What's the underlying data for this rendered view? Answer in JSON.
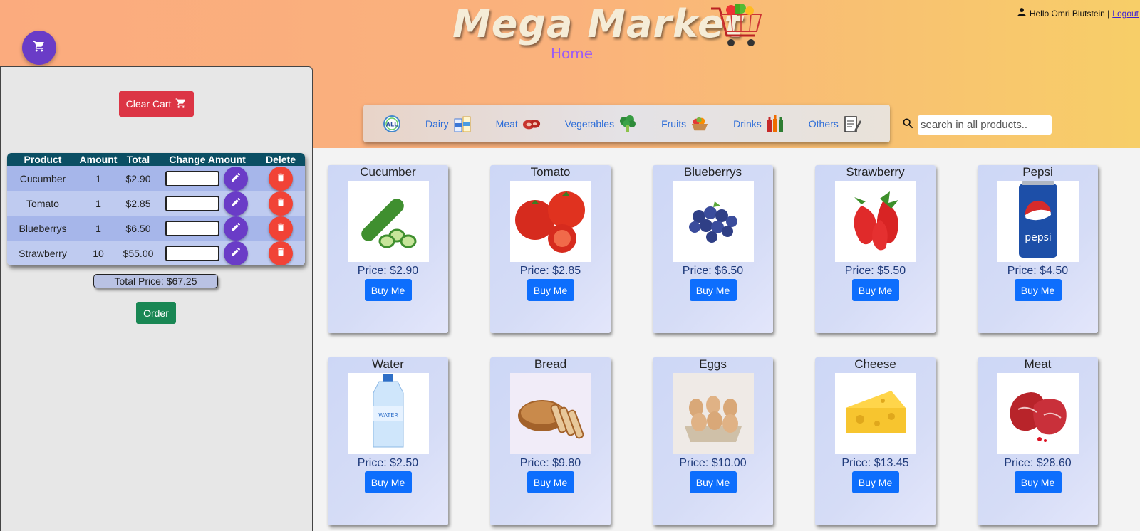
{
  "header": {
    "brand": "Mega Market",
    "nav_home": "Home",
    "greeting": "Hello Omri Blutstein |",
    "logout": "Logout"
  },
  "cart": {
    "clear_label": "Clear Cart",
    "columns": [
      "Product",
      "Amount",
      "Total",
      "Change Amount",
      "Delete"
    ],
    "rows": [
      {
        "product": "Cucumber",
        "amount": "1",
        "total": "$2.90"
      },
      {
        "product": "Tomato",
        "amount": "1",
        "total": "$2.85"
      },
      {
        "product": "Blueberrys",
        "amount": "1",
        "total": "$6.50"
      },
      {
        "product": "Strawberry",
        "amount": "10",
        "total": "$55.00"
      }
    ],
    "total_price": "Total Price: $67.25",
    "order_label": "Order"
  },
  "categories": {
    "items": [
      {
        "label": "ALL",
        "icon": "all-icon"
      },
      {
        "label": "Dairy",
        "icon": "dairy-icon"
      },
      {
        "label": "Meat",
        "icon": "meat-icon"
      },
      {
        "label": "Vegetables",
        "icon": "broccoli-icon"
      },
      {
        "label": "Fruits",
        "icon": "fruit-basket-icon"
      },
      {
        "label": "Drinks",
        "icon": "bottles-icon"
      },
      {
        "label": "Others",
        "icon": "notepad-icon"
      }
    ]
  },
  "search": {
    "placeholder": "search in all products.."
  },
  "products": [
    {
      "name": "Cucumber",
      "price": "Price: $2.90",
      "buy": "Buy Me",
      "image": "cucumber"
    },
    {
      "name": "Tomato",
      "price": "Price: $2.85",
      "buy": "Buy Me",
      "image": "tomato"
    },
    {
      "name": "Blueberrys",
      "price": "Price: $6.50",
      "buy": "Buy Me",
      "image": "blueberries"
    },
    {
      "name": "Strawberry",
      "price": "Price: $5.50",
      "buy": "Buy Me",
      "image": "strawberry"
    },
    {
      "name": "Pepsi",
      "price": "Price: $4.50",
      "buy": "Buy Me",
      "image": "pepsi-can"
    },
    {
      "name": "Water",
      "price": "Price: $2.50",
      "buy": "Buy Me",
      "image": "water-bottle"
    },
    {
      "name": "Bread",
      "price": "Price: $9.80",
      "buy": "Buy Me",
      "image": "bread"
    },
    {
      "name": "Eggs",
      "price": "Price: $10.00",
      "buy": "Buy Me",
      "image": "eggs"
    },
    {
      "name": "Cheese",
      "price": "Price: $13.45",
      "buy": "Buy Me",
      "image": "cheese"
    },
    {
      "name": "Meat",
      "price": "Price: $28.60",
      "buy": "Buy Me",
      "image": "raw-meat"
    }
  ],
  "colors": {
    "header_gradient_start": "#fbab7e",
    "header_gradient_end": "#f7ce68",
    "primary_blue": "#0d6efd",
    "danger_red": "#dc3545",
    "purple": "#6a3cc7",
    "order_green": "#198754"
  }
}
